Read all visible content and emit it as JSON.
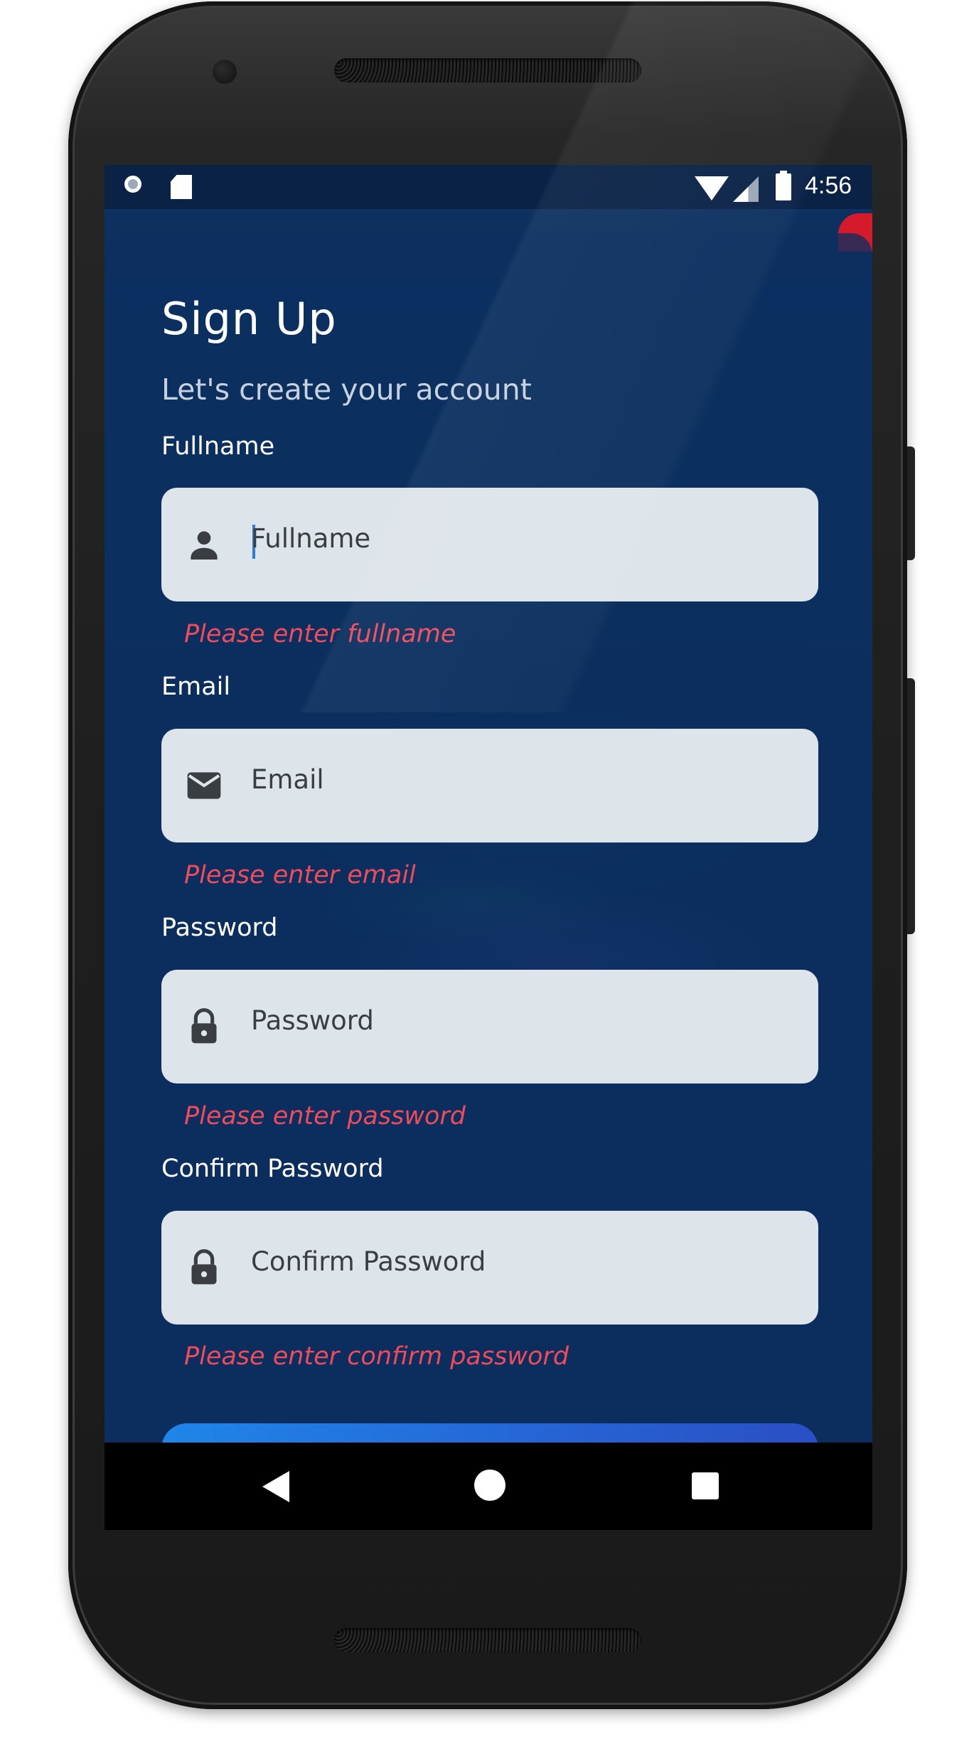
{
  "status_bar": {
    "time": "4:56",
    "icons": [
      "sync-circle-icon",
      "sd-card-icon",
      "wifi-icon",
      "cell-signal-icon",
      "battery-icon"
    ]
  },
  "form": {
    "title": "Sign Up",
    "subtitle": "Let's create your account",
    "fields": [
      {
        "label": "Fullname",
        "placeholder": "Fullname",
        "error": "Please enter fullname",
        "icon": "person-icon"
      },
      {
        "label": "Email",
        "placeholder": "Email",
        "error": "Please enter email",
        "icon": "mail-icon"
      },
      {
        "label": "Password",
        "placeholder": "Password",
        "error": "Please enter password",
        "icon": "lock-icon"
      },
      {
        "label": "Confirm Password",
        "placeholder": "Confirm Password",
        "error": "Please enter confirm password",
        "icon": "lock-icon"
      }
    ]
  },
  "nav_bar": {
    "icons": [
      "back-icon",
      "home-icon",
      "recents-icon"
    ]
  },
  "colors": {
    "card_bg": "#0c3060",
    "field_bg": "#dde4ea",
    "error": "#ef4b5b",
    "button_start": "#1f86e8",
    "button_end": "#2a4fc4"
  }
}
